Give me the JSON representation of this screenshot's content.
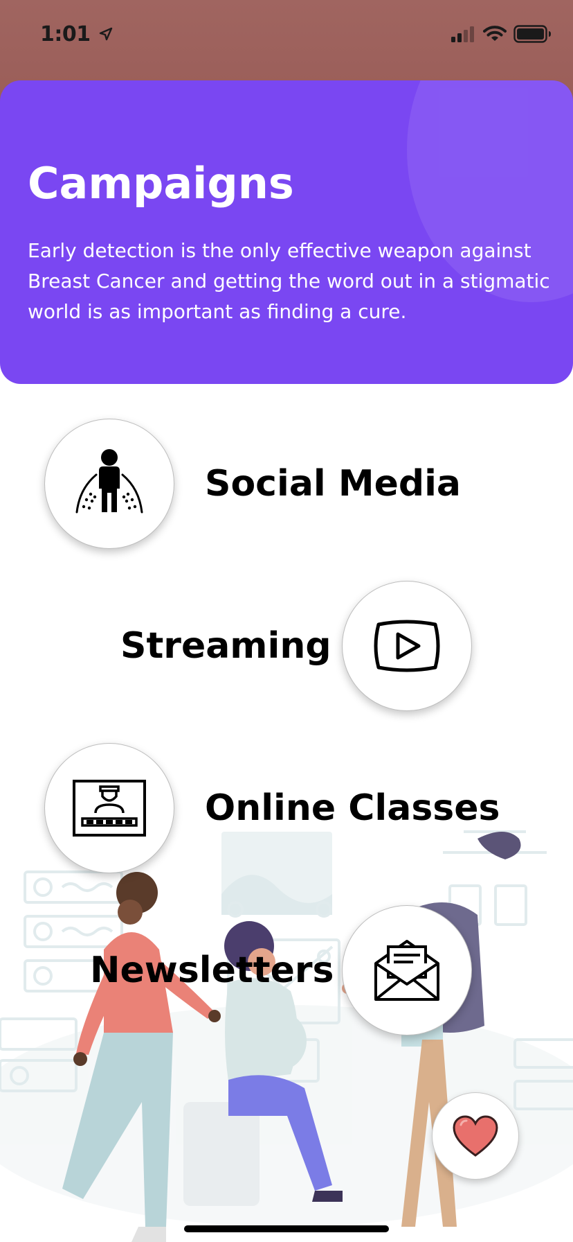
{
  "status_bar": {
    "time": "1:01"
  },
  "header": {
    "title": "Campaigns",
    "description": "Early detection is the only effective weapon against Breast Cancer and getting the word out in a stigmatic world is as important as finding a cure."
  },
  "campaigns": [
    {
      "label": "Social Media",
      "icon": "person-speaking-icon"
    },
    {
      "label": "Streaming",
      "icon": "play-video-icon"
    },
    {
      "label": "Online Classes",
      "icon": "online-class-icon"
    },
    {
      "label": "Newsletters",
      "icon": "envelope-icon"
    }
  ],
  "favorite": {
    "icon": "heart-icon"
  },
  "colors": {
    "header_bg": "#7a47f2",
    "status_bar_bg": "#9e615c",
    "heart": "#e8706c"
  }
}
